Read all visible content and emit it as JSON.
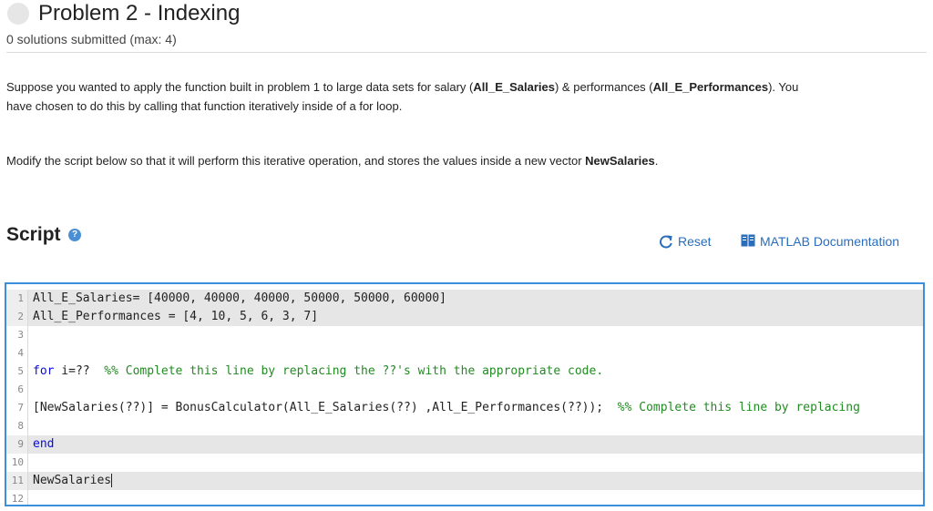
{
  "problem": {
    "title": "Problem 2 - Indexing",
    "submissions": "0 solutions submitted (max: 4)"
  },
  "description": {
    "p1_a": "Suppose you wanted to apply the function built in problem 1 to large data sets for salary (",
    "p1_b": "All_E_Salaries",
    "p1_c": ") & performances (",
    "p1_d": "All_E_Performances",
    "p1_e": ").  You",
    "p1_f": "have chosen to do this by calling that function iteratively inside of a for loop.",
    "p2_a": "Modify the script below so that it will perform this iterative operation, and stores the values inside a new vector ",
    "p2_b": "NewSalaries",
    "p2_c": "."
  },
  "script": {
    "heading": "Script",
    "help_icon": "?",
    "reset_label": "Reset",
    "docs_label": "MATLAB Documentation"
  },
  "icons": {
    "status": "status-circle-icon",
    "help": "question-circle-icon",
    "reset": "reset-arrow-icon",
    "docs": "book-icon"
  },
  "colors": {
    "editor_border": "#3c8fdc",
    "keyword": "#0a0ae0",
    "comment": "#228b22",
    "link": "#2a6ebb",
    "shaded_line": "#e6e6e6"
  },
  "editor": {
    "lines": [
      {
        "num": "1",
        "code": "All_E_Salaries= [40000, 40000, 40000, 50000, 50000, 60000]"
      },
      {
        "num": "2",
        "code": "All_E_Performances = [4, 10, 5, 6, 3, 7]"
      },
      {
        "num": "3",
        "code": ""
      },
      {
        "num": "4",
        "code": ""
      },
      {
        "num": "5",
        "kw": "for",
        "code": " i=??  ",
        "comment": "%% Complete this line by replacing the ??'s with the appropriate code."
      },
      {
        "num": "6",
        "code": ""
      },
      {
        "num": "7",
        "code": "[NewSalaries(??)] = BonusCalculator(All_E_Salaries(??) ,All_E_Performances(??));  ",
        "comment": "%% Complete this line by replacing"
      },
      {
        "num": "8",
        "code": ""
      },
      {
        "num": "9",
        "kw": "end",
        "code": ""
      },
      {
        "num": "10",
        "code": ""
      },
      {
        "num": "11",
        "code": "NewSalaries"
      },
      {
        "num": "12",
        "code": ""
      }
    ]
  }
}
